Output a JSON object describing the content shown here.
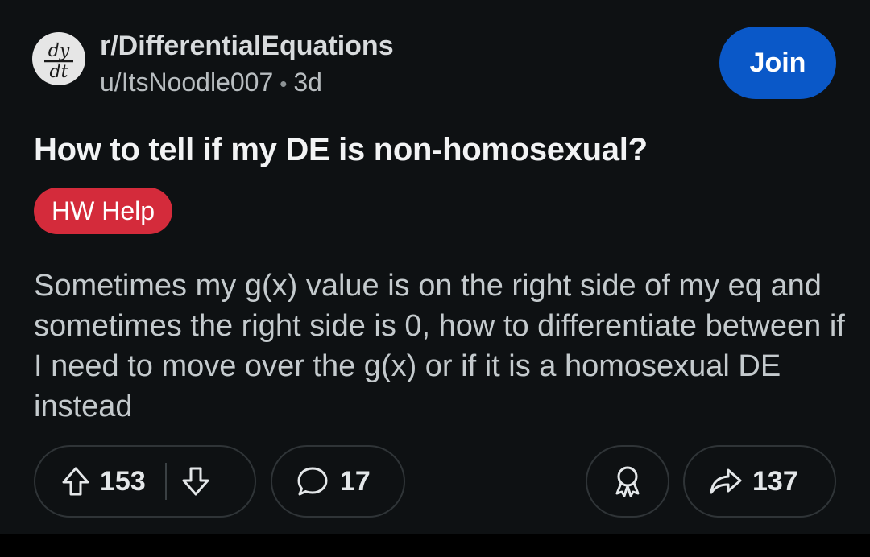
{
  "post": {
    "subreddit": "r/DifferentialEquations",
    "username": "u/ItsNoodle007",
    "separator": "•",
    "age": "3d",
    "join_label": "Join",
    "title": "How to tell if my DE is non-homosexual?",
    "flair": "HW Help",
    "body": "Sometimes my g(x) value is on the right side of my eq and sometimes the right side is 0, how to differentiate between if I need to move over the g(x) or if it is a homosexual DE instead",
    "avatar_text_top": "dy",
    "avatar_text_bottom": "dt"
  },
  "actions": {
    "upvotes": "153",
    "comments": "17",
    "shares": "137"
  },
  "colors": {
    "background": "#0e1113",
    "join": "#0a58c8",
    "flair": "#d42b3b"
  },
  "icons": [
    "upvote-icon",
    "downvote-icon",
    "comment-icon",
    "award-icon",
    "share-icon"
  ]
}
